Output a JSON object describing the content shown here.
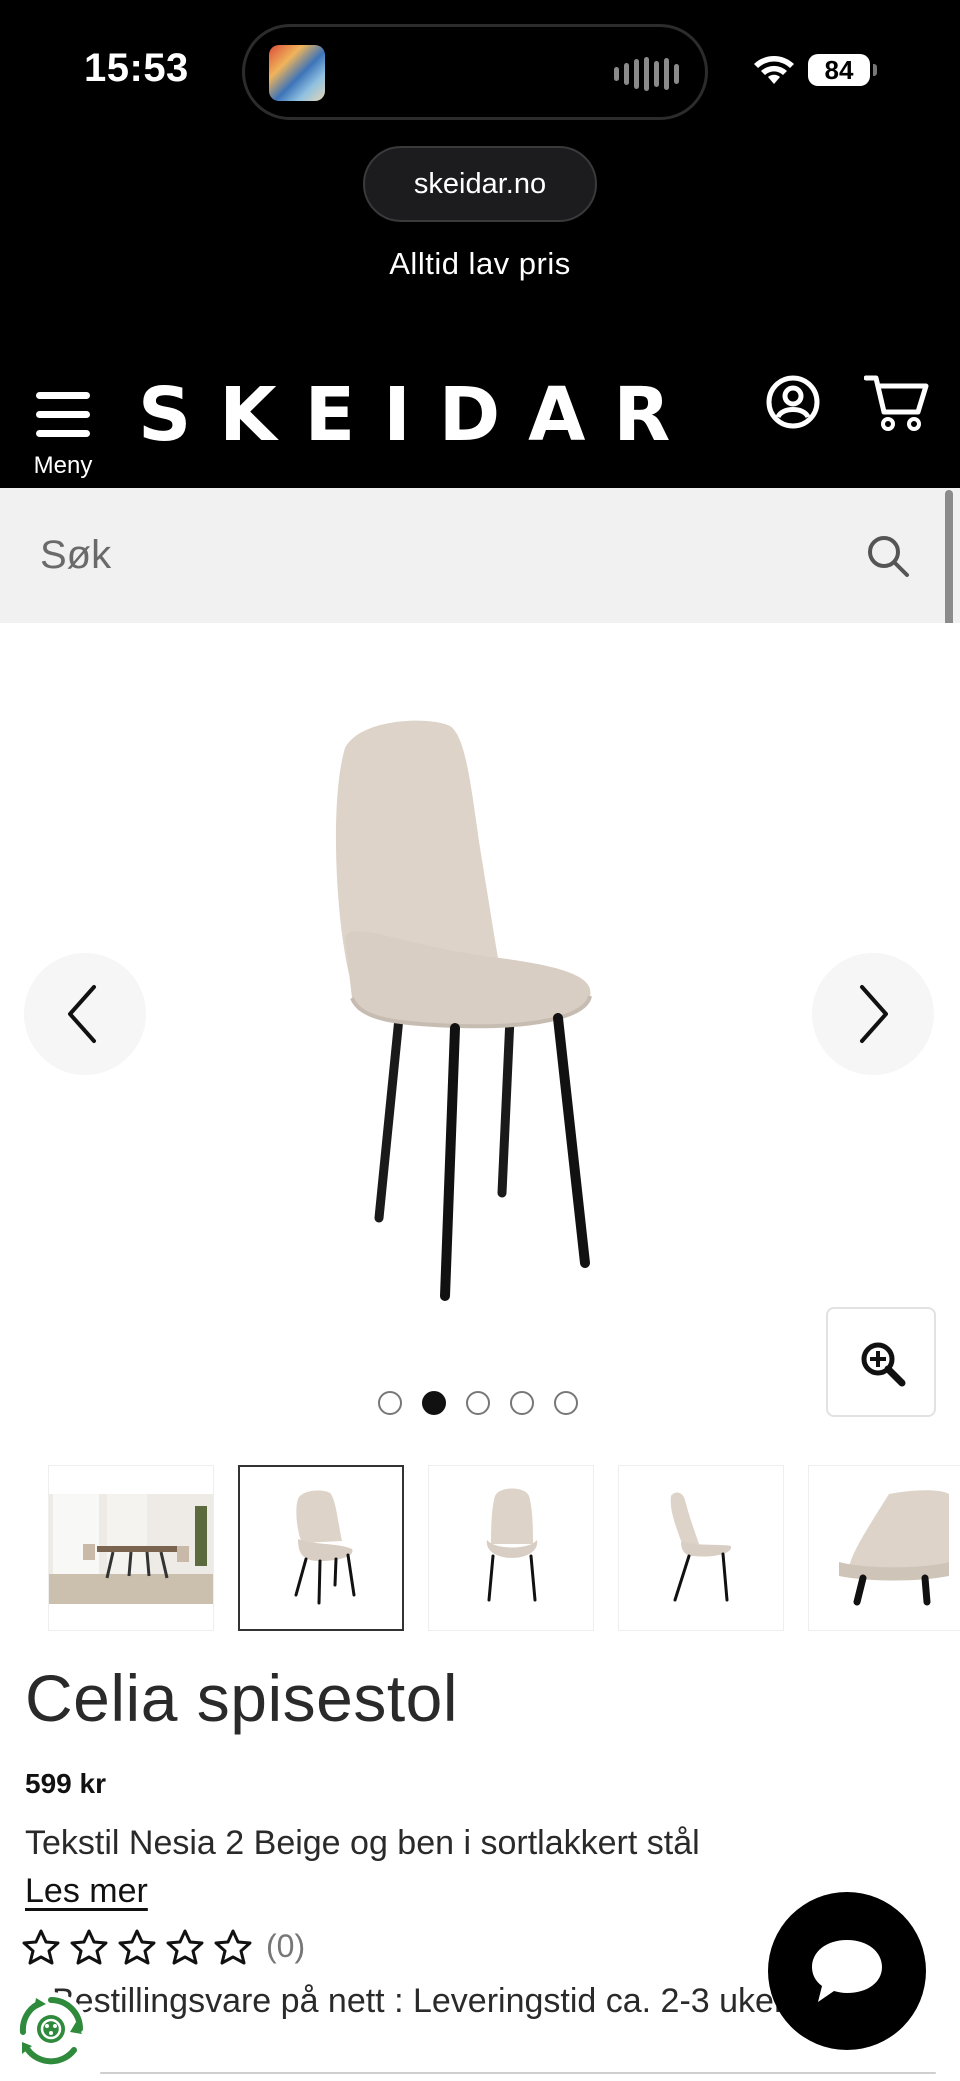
{
  "status_bar": {
    "time": "15:53",
    "battery": "84"
  },
  "browser": {
    "url": "skeidar.no"
  },
  "promo_banner": "Alltid lav pris",
  "header": {
    "menu_label": "Meny",
    "logo": "SKEIDAR",
    "icons": [
      "menu-icon",
      "account-icon",
      "cart-icon"
    ]
  },
  "search": {
    "placeholder": "Søk",
    "icon": "search-icon"
  },
  "gallery": {
    "image_count": 5,
    "active_index": 1,
    "prev_icon": "chevron-left-icon",
    "next_icon": "chevron-right-icon",
    "zoom_icon": "zoom-in-icon"
  },
  "product": {
    "title": "Celia spisestol",
    "price": "599 kr",
    "description": "Tekstil Nesia 2 Beige og ben i sortlakkert stål",
    "read_more": "Les mer",
    "rating_count": "(0)",
    "stars_filled": 0,
    "stars_total": 5,
    "stock": "Bestillingsvare på nett : Leveringstid ca. 2-3 uker"
  },
  "colors": {
    "header_bg": "#000000",
    "search_bg": "#f1f1f1",
    "chair_fabric": "#ddd3c9",
    "chair_legs": "#1a1a1a",
    "eco_green": "#2f8a3c"
  }
}
